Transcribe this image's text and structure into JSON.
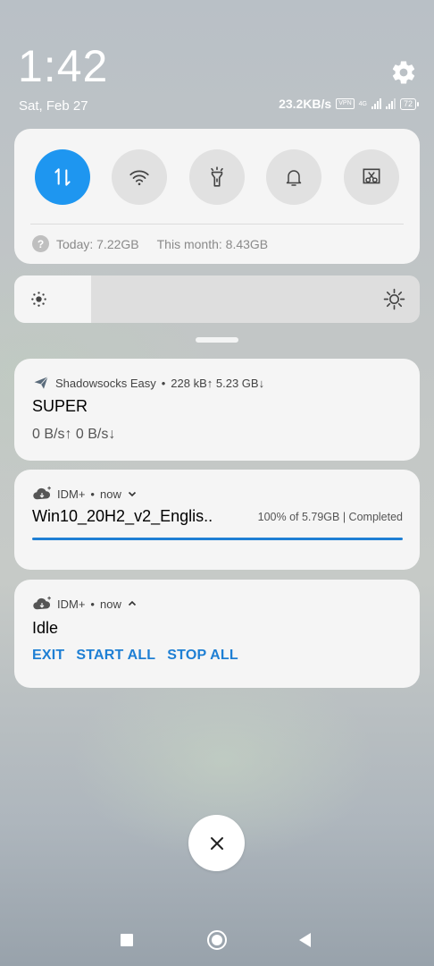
{
  "status_bar": {
    "time": "1:42",
    "date": "Sat, Feb 27",
    "net_speed": "23.2KB/s",
    "vpn_label": "VPN",
    "network_type": "4G",
    "battery": "72"
  },
  "quick_settings": {
    "toggles": [
      {
        "name": "mobile-data",
        "icon": "data-transfer-icon",
        "active": true
      },
      {
        "name": "wifi",
        "icon": "wifi-icon",
        "active": false
      },
      {
        "name": "flashlight",
        "icon": "flashlight-icon",
        "active": false
      },
      {
        "name": "sound",
        "icon": "bell-icon",
        "active": false
      },
      {
        "name": "screenshot",
        "icon": "screenshot-icon",
        "active": false
      }
    ],
    "data_today": "Today: 7.22GB",
    "data_month": "This month: 8.43GB",
    "help_icon": "?"
  },
  "brightness": {
    "level": 0.19
  },
  "notifications": [
    {
      "app": "Shadowsocks Easy",
      "separator": "•",
      "traffic": "228 kB↑  5.23 GB↓",
      "title": "SUPER",
      "text": "0 B/s↑ 0 B/s↓"
    },
    {
      "app": "IDM+",
      "separator": "•",
      "time": "now",
      "title": "Win10_20H2_v2_Englis..",
      "status": "100% of 5.79GB | Completed",
      "progress": 1.0
    },
    {
      "app": "IDM+",
      "separator": "•",
      "time": "now",
      "title": "Idle",
      "actions": [
        "EXIT",
        "START ALL",
        "STOP ALL"
      ]
    }
  ],
  "colors": {
    "accent": "#1e96f0",
    "action": "#1e7fd4",
    "card": "#f5f5f5"
  }
}
